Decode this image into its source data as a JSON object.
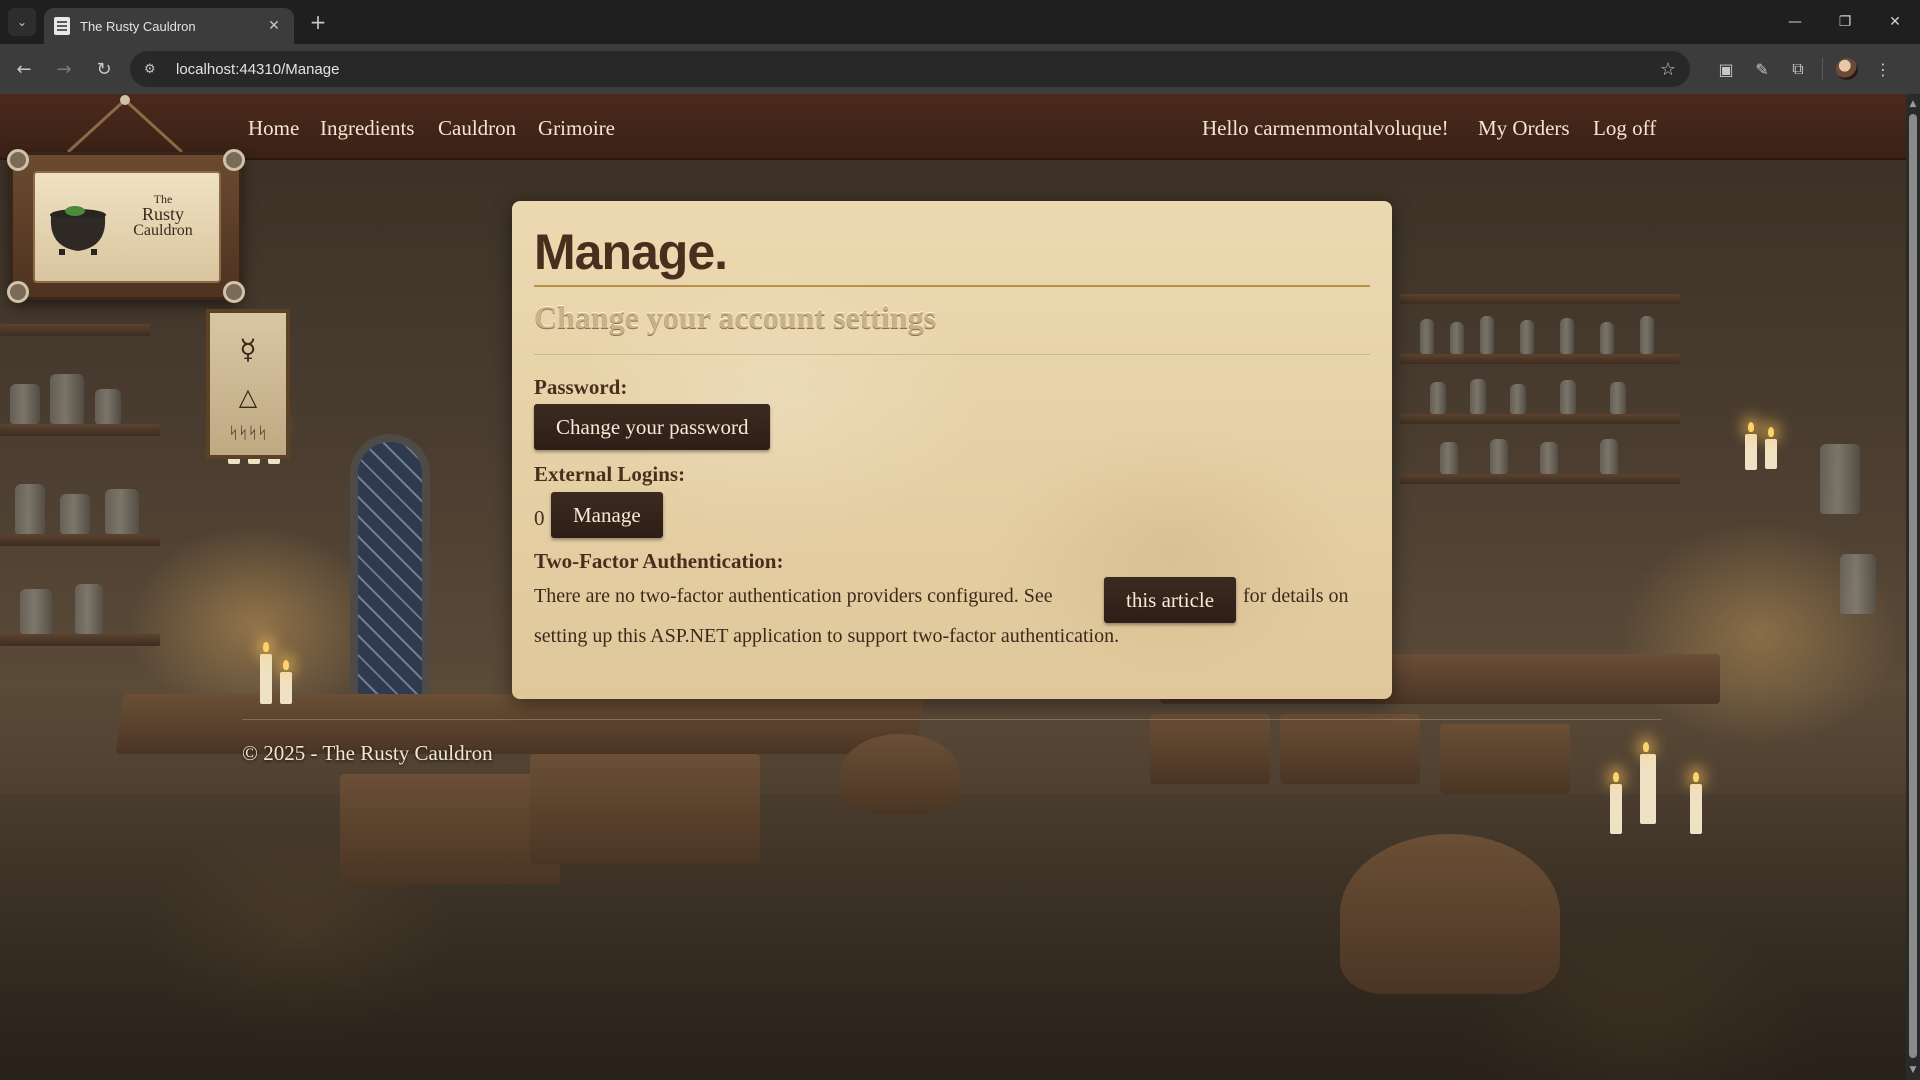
{
  "browser": {
    "tab_title": "The Rusty Cauldron",
    "url": "localhost:44310/Manage",
    "icons": [
      "tab-list-icon",
      "favicon-icon",
      "close-icon",
      "plus-icon",
      "back-icon",
      "forward-icon",
      "reload-icon",
      "site-info-icon",
      "star-icon",
      "extension-icon",
      "profile-avatar-icon",
      "more-icon"
    ]
  },
  "nav": {
    "left": [
      "Home",
      "Ingredients",
      "Cauldron",
      "Grimoire"
    ],
    "greeting": "Hello carmenmontalvoluque!",
    "orders": "My Orders",
    "logoff": "Log off"
  },
  "logo": {
    "the": "The",
    "rusty": "Rusty",
    "cauldron": "Cauldron"
  },
  "page": {
    "title": "Manage.",
    "subtitle": "Change your account settings",
    "password_label": "Password:",
    "change_password_button": "Change your password",
    "external_logins_label": "External Logins:",
    "external_logins_count": "0",
    "manage_button": "Manage",
    "two_factor_label": "Two-Factor Authentication:",
    "two_factor_text_1": "There are no two-factor authentication providers configured. See",
    "article_button": "this article",
    "two_factor_text_2": "for details on",
    "two_factor_text_3": "setting up this ASP.NET application to support two-factor authentication."
  },
  "footer": {
    "text": "© 2025 - The Rusty Cauldron"
  },
  "colors": {
    "nav_bg": "#4a2a1c",
    "card_bg": "#e6d1a6",
    "button_bg": "#2d1f17",
    "heading": "#4a2e1d",
    "rule": "#b9924a"
  }
}
